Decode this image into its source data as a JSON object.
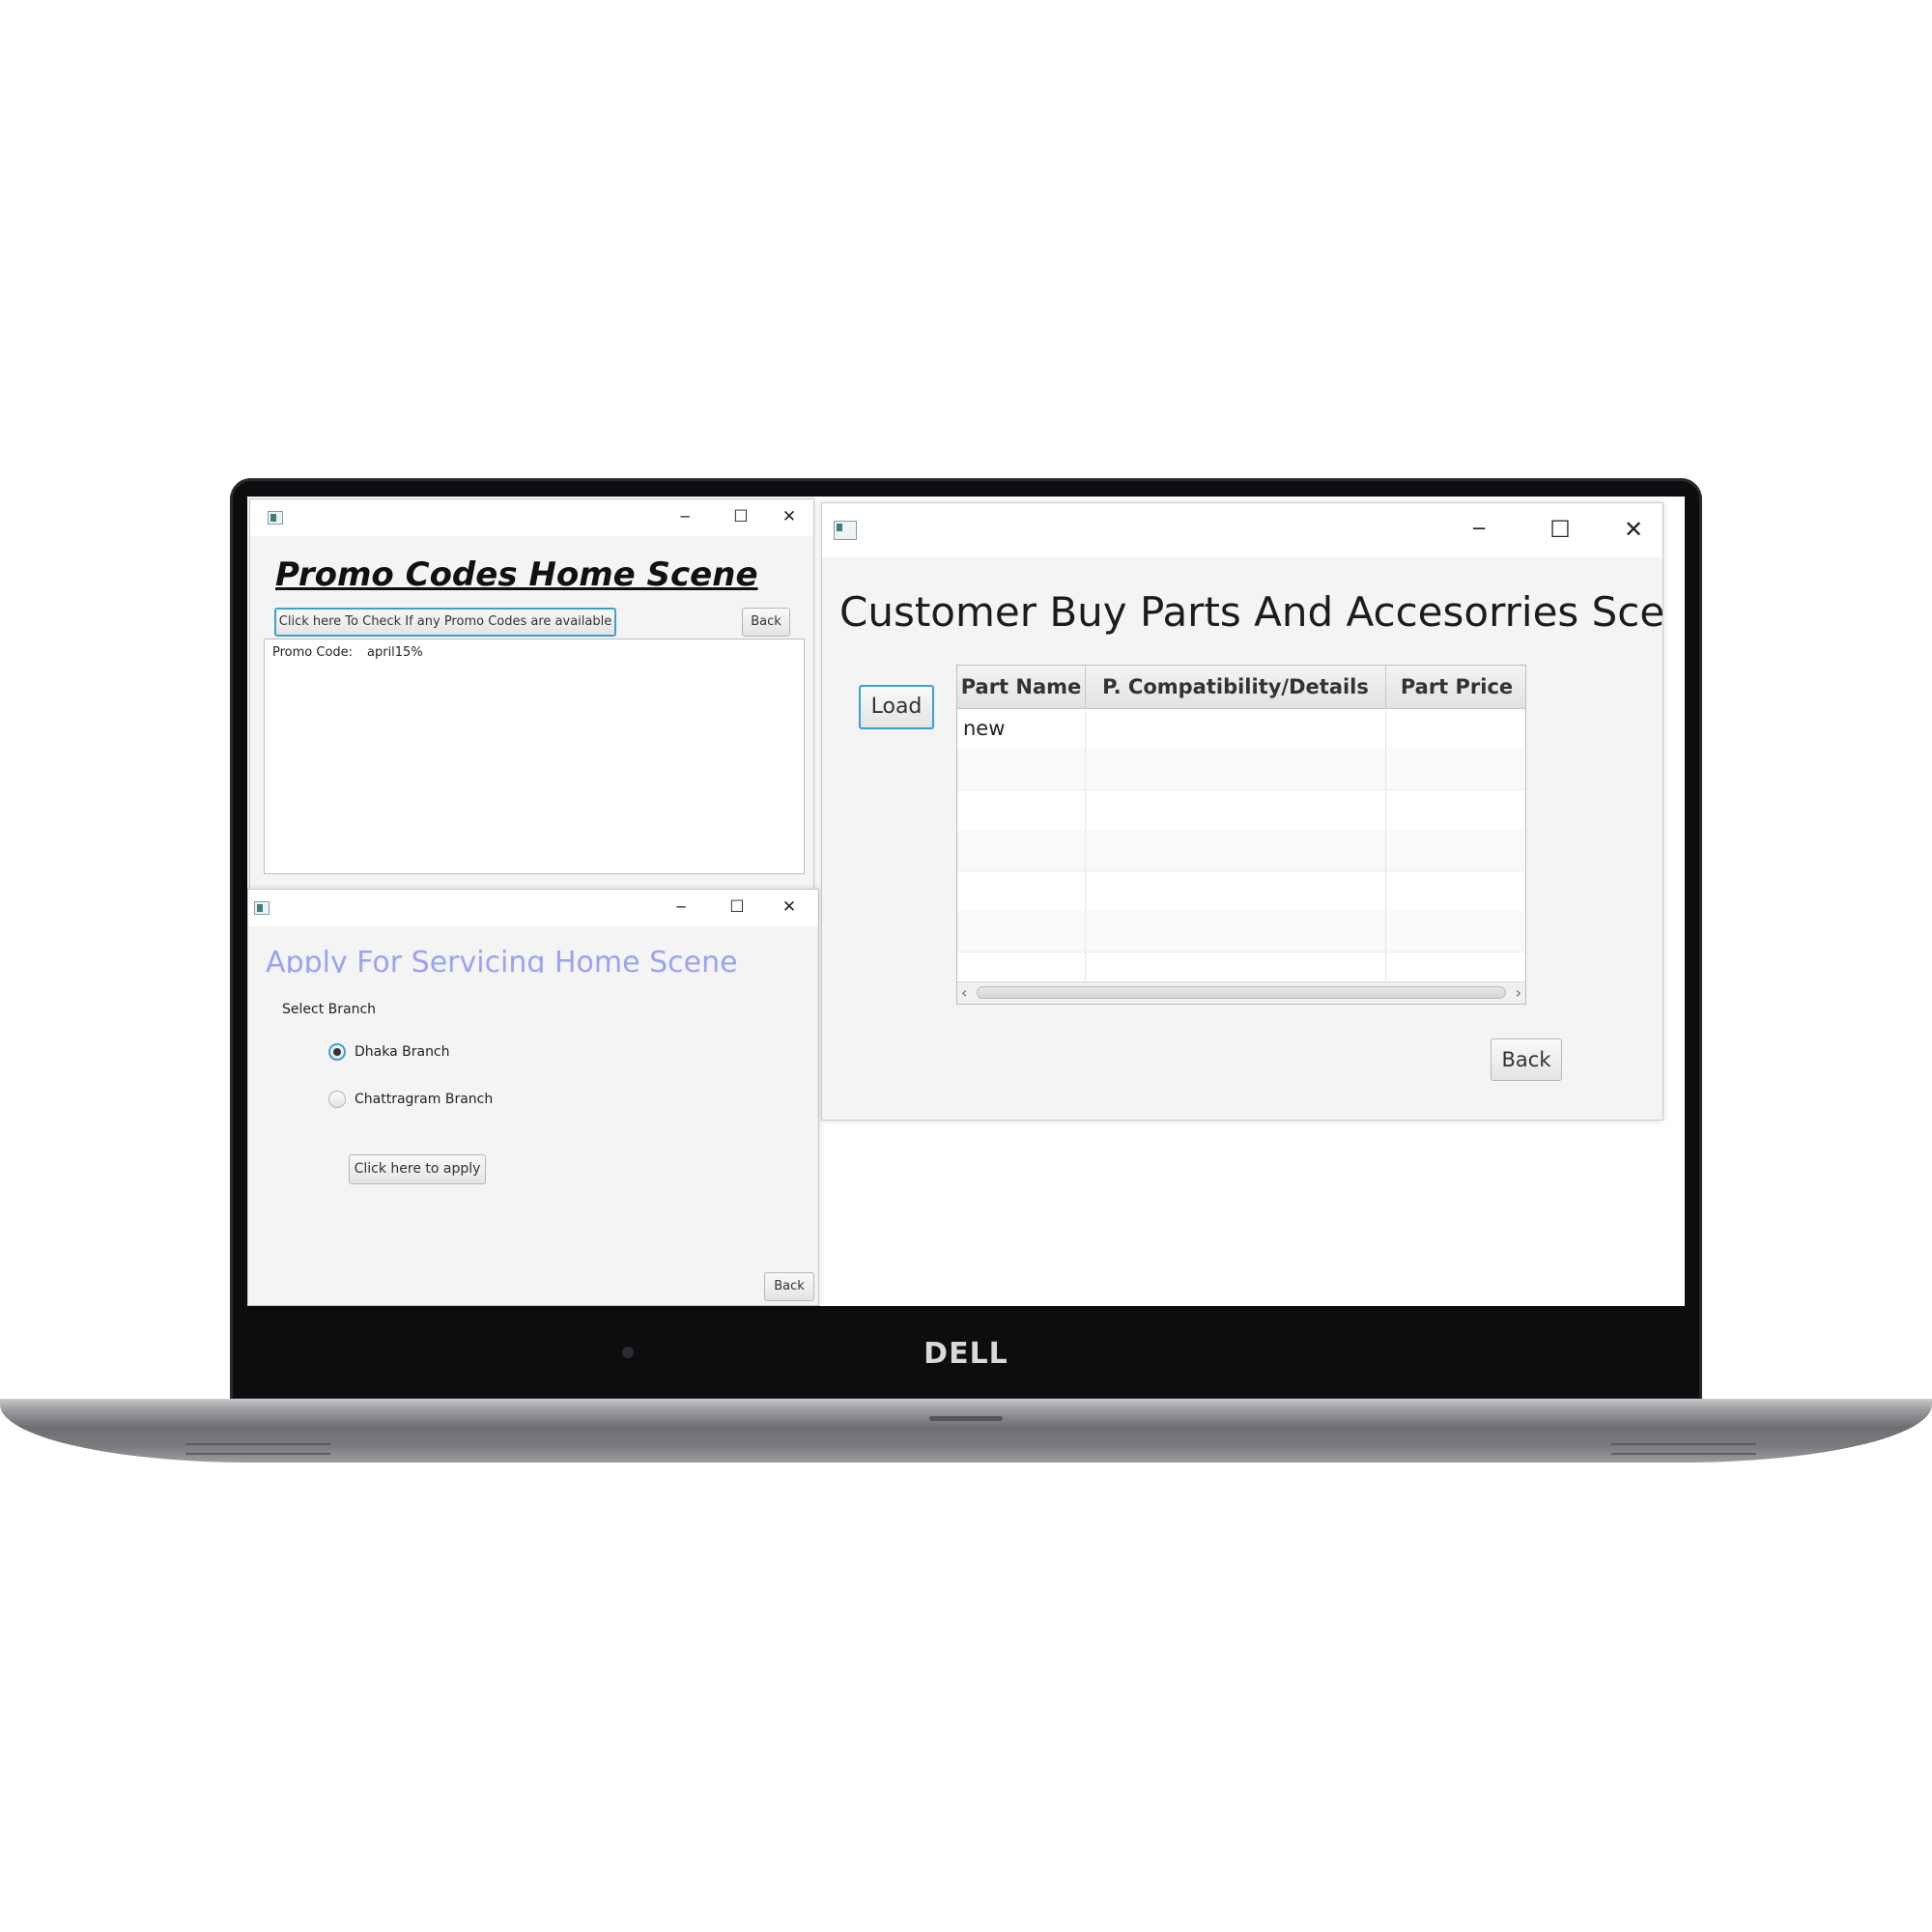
{
  "device": {
    "brand": "DELL"
  },
  "promo_window": {
    "title": "Promo Codes Home Scene",
    "check_button": "Click here To Check If any Promo Codes are available",
    "back_button": "Back",
    "result_label": "Promo Code:",
    "result_value": "april15%",
    "controls": {
      "minimize": "─",
      "maximize": "☐",
      "close": "✕"
    }
  },
  "service_window": {
    "title": "Apply For Servicing Home Scene",
    "select_label": "Select Branch",
    "options": [
      {
        "label": "Dhaka Branch",
        "selected": true
      },
      {
        "label": "Chattragram Branch",
        "selected": false
      }
    ],
    "apply_button": "Click here to apply",
    "back_button": "Back",
    "controls": {
      "minimize": "─",
      "maximize": "☐",
      "close": "✕"
    }
  },
  "parts_window": {
    "title": "Customer Buy Parts And Accesorries Scene",
    "load_button": "Load",
    "back_button": "Back",
    "table": {
      "columns": [
        "Part Name",
        "P. Compatibility/Details",
        "Part Price"
      ],
      "rows": [
        [
          "new",
          "",
          ""
        ]
      ]
    },
    "scroll_left": "‹",
    "scroll_right": "›",
    "controls": {
      "minimize": "─",
      "maximize": "☐",
      "close": "✕"
    }
  },
  "colors": {
    "focus_accent": "#3aa0d6",
    "service_title": "#9aa3f0",
    "window_bg": "#f4f4f4"
  }
}
